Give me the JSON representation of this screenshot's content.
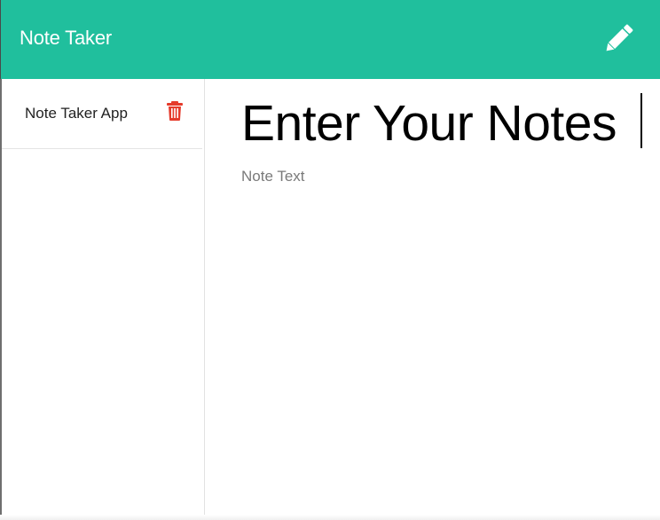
{
  "navbar": {
    "brand": "Note Taker",
    "new_note_icon": "pencil-icon",
    "background_color": "#20bf9d"
  },
  "sidebar": {
    "notes": [
      {
        "title": "Note Taker App",
        "delete_icon": "trash-icon"
      }
    ],
    "delete_color": "#e53b2c"
  },
  "editor": {
    "title_placeholder": "Enter Your Notes",
    "text_placeholder": "Note Text"
  }
}
